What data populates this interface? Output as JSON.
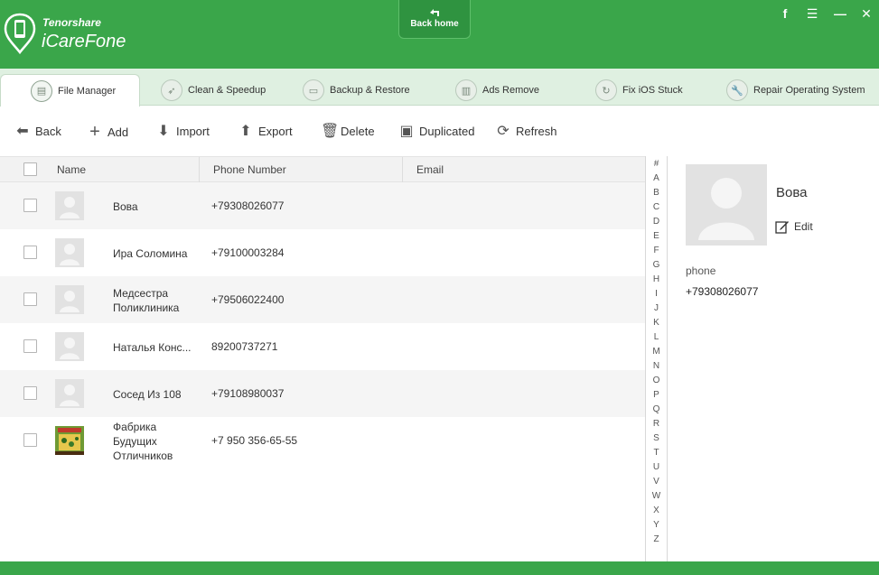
{
  "app": {
    "company": "Tenorshare",
    "name": "iCareFone",
    "back_home": "Back home"
  },
  "tabs": [
    {
      "label": "File Manager",
      "icon": "file-manager-icon",
      "active": true
    },
    {
      "label": "Clean & Speedup",
      "icon": "rocket-icon"
    },
    {
      "label": "Backup & Restore",
      "icon": "folder-icon"
    },
    {
      "label": "Ads Remove",
      "icon": "trash-icon"
    },
    {
      "label": "Fix iOS Stuck",
      "icon": "refresh-icon"
    },
    {
      "label": "Repair Operating System",
      "icon": "wrench-icon"
    }
  ],
  "toolbar": {
    "back": "Back",
    "add": "Add",
    "import": "Import",
    "export": "Export",
    "delete": "Delete",
    "duplicated": "Duplicated",
    "refresh": "Refresh"
  },
  "table": {
    "headers": {
      "name": "Name",
      "phone": "Phone Number",
      "email": "Email"
    },
    "rows": [
      {
        "name": "Вова",
        "phone": "+79308026077",
        "photo": false
      },
      {
        "name": "Ира Соломина",
        "phone": "+79100003284",
        "photo": false
      },
      {
        "name": "Медсестра Поликлиника",
        "phone": "+79506022400",
        "photo": false
      },
      {
        "name": "Наталья Конс...",
        "phone": "89200737271",
        "photo": false
      },
      {
        "name": "Сосед Из 108",
        "phone": "+79108980037",
        "photo": false
      },
      {
        "name": "Фабрика Будущих Отличников",
        "phone": "+7 950 356-65-55",
        "photo": true
      }
    ]
  },
  "alphabet": [
    "#",
    "A",
    "B",
    "C",
    "D",
    "E",
    "F",
    "G",
    "H",
    "I",
    "J",
    "K",
    "L",
    "M",
    "N",
    "O",
    "P",
    "Q",
    "R",
    "S",
    "T",
    "U",
    "V",
    "W",
    "X",
    "Y",
    "Z"
  ],
  "detail": {
    "name": "Вова",
    "edit": "Edit",
    "phone_label": "phone",
    "phone_value": "+79308026077"
  },
  "colors": {
    "brand_green": "#3aa64a",
    "tab_bar": "#dff0e1",
    "row_alt": "#f5f5f5"
  }
}
